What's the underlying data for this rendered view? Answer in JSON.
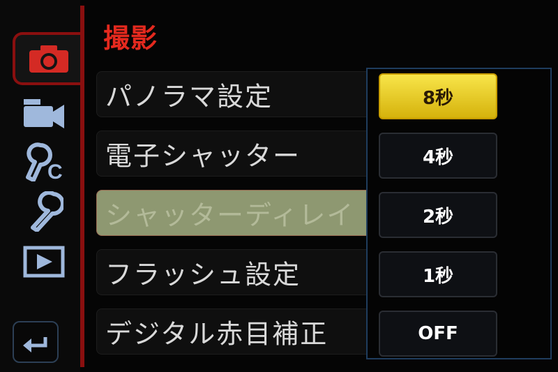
{
  "menu_tab_icons": [
    "camera-icon",
    "video-camera-icon",
    "custom-wrench-icon",
    "wrench-icon",
    "playback-icon"
  ],
  "back_icon": "return-arrow-icon",
  "page": {
    "title": "撮影"
  },
  "menu_items": [
    {
      "label": "パノラマ設定"
    },
    {
      "label": "電子シャッター"
    },
    {
      "label": "シャッターディレイ"
    },
    {
      "label": "フラッシュ設定"
    },
    {
      "label": "デジタル赤目補正"
    }
  ],
  "selected_menu_item": "シャッターディレイ",
  "options": [
    {
      "label": "8秒"
    },
    {
      "label": "4秒"
    },
    {
      "label": "2秒"
    },
    {
      "label": "1秒"
    },
    {
      "label": "OFF"
    }
  ],
  "selected_option": "8秒",
  "colors": {
    "accent_red": "#e4291e",
    "divider_red": "#8a0f0f",
    "highlight_yellow": "#f0d52e",
    "selected_row": "#8e9871",
    "icon_blue": "#9fb8dc"
  }
}
